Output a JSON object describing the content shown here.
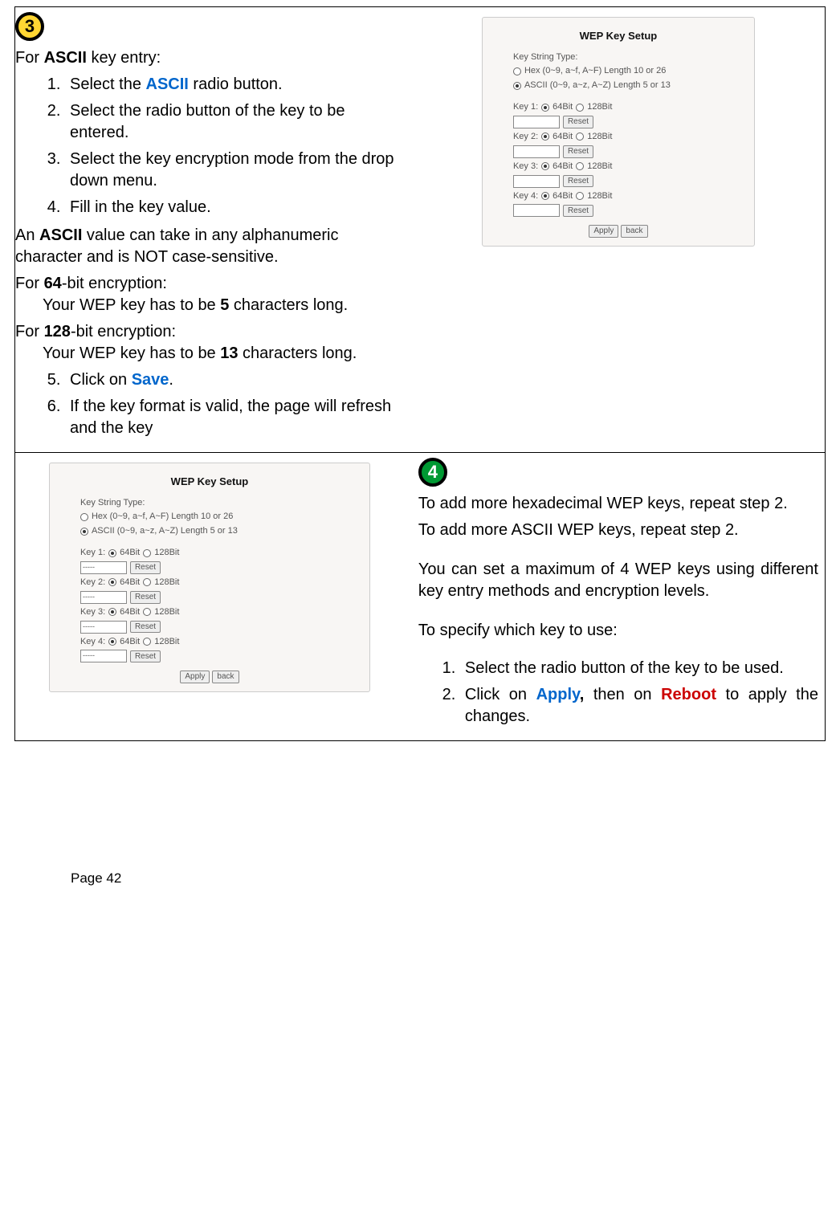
{
  "step3": {
    "badge": "3",
    "intro_prefix": "For ",
    "intro_bold": "ASCII",
    "intro_suffix": " key entry:",
    "li1_a": "Select the ",
    "li1_b": "ASCII",
    "li1_c": " radio button.",
    "li2": "Select the radio button of the key to be entered.",
    "li3": "Select the key encryption mode from the drop down menu.",
    "li4": "Fill in the key value.",
    "ascii_a": "An ",
    "ascii_b": "ASCII",
    "ascii_c": " value can take in any alphanumeric character and is NOT case-sensitive.",
    "enc64_a": "For ",
    "enc64_b": "64",
    "enc64_c": "-bit encryption:",
    "enc64_body_a": "Your WEP key has to be ",
    "enc64_body_b": "5",
    "enc64_body_c": " characters long.",
    "enc128_a": "For ",
    "enc128_b": "128",
    "enc128_c": "-bit encryption:",
    "enc128_body_a": "Your WEP key has to be ",
    "enc128_body_b": "13",
    "enc128_body_c": " characters long.",
    "li5_a": "Click on ",
    "li5_b": "Save",
    "li5_c": ".",
    "li6": "If the key format is valid, the page will refresh and the key"
  },
  "step4": {
    "badge": "4",
    "p1": "To add more hexadecimal WEP keys, repeat step 2.",
    "p2": "To add more ASCII WEP keys, repeat step 2.",
    "p3": "You can set a maximum of 4 WEP keys using different key entry methods and encryption levels.",
    "p4": "To specify which key to use:",
    "li1": "Select the radio button of the key to be used.",
    "li2_a": "Click on ",
    "li2_b": "Apply",
    "li2_c": ", ",
    "li2_d": "then on ",
    "li2_e": "Reboot",
    "li2_f": " to apply the changes."
  },
  "sshot1": {
    "title": "WEP Key Setup",
    "kst": "Key String Type:",
    "hex": "Hex (0~9, a~f, A~F) Length 10 or 26",
    "ascii": "ASCII (0~9, a~z, A~Z) Length 5 or 13",
    "k1": "Key 1:",
    "k2": "Key 2:",
    "k3": "Key 3:",
    "k4": "Key 4:",
    "b64": "64Bit",
    "b128": "128Bit",
    "reset": "Reset",
    "apply": "Apply",
    "back": "back"
  },
  "sshot2": {
    "title": "WEP Key Setup",
    "kst": "Key String Type:",
    "hex": "Hex (0~9, a~f, A~F) Length 10 or 26",
    "ascii": "ASCII (0~9, a~z, A~Z) Length 5 or 13",
    "k1": "Key 1:",
    "k2": "Key 2:",
    "k3": "Key 3:",
    "k4": "Key 4:",
    "b64": "64Bit",
    "b128": "128Bit",
    "reset": "Reset",
    "apply": "Apply",
    "back": "back",
    "masked": "-----"
  },
  "footer": {
    "page": "Page 42"
  }
}
